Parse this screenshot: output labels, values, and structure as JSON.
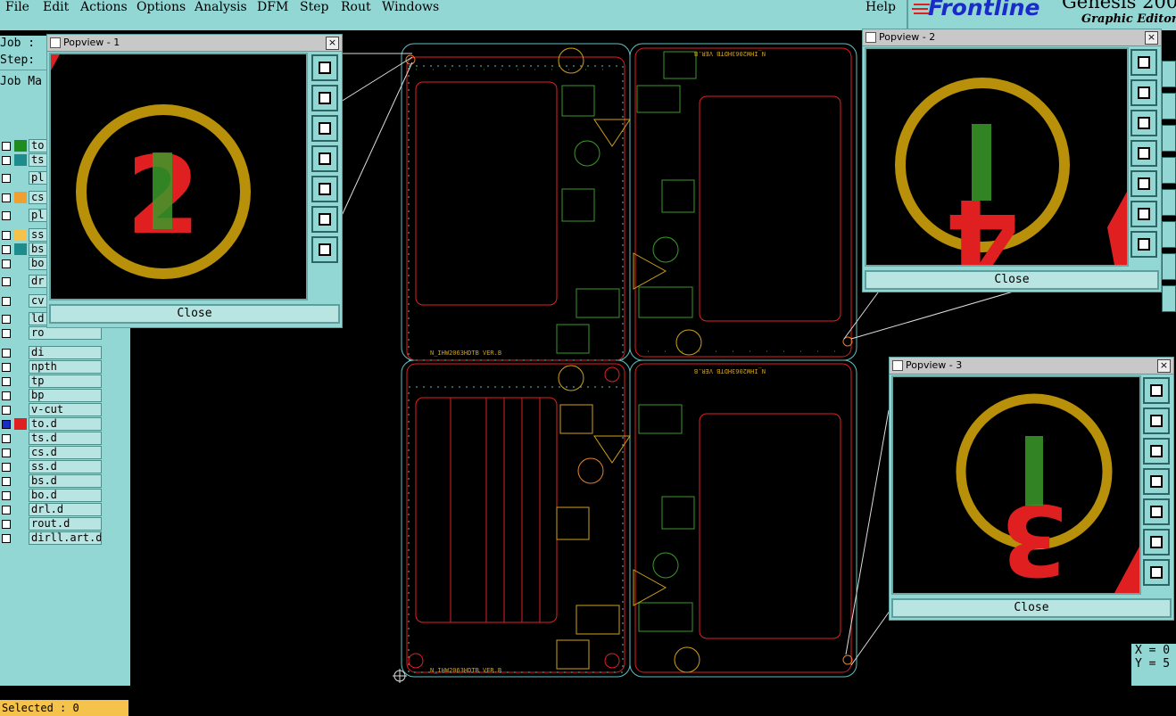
{
  "menu": {
    "items": [
      "File",
      "Edit",
      "Actions",
      "Options",
      "Analysis",
      "DFM",
      "Step",
      "Rout",
      "Windows"
    ],
    "help": "Help"
  },
  "logo": {
    "brand": "Frontline",
    "product": "Genesis 2000",
    "subtitle": "Graphic Editor"
  },
  "left_panel": {
    "job_label": "Job :",
    "step_label": "Step:",
    "job_matrix_label": "Job Ma",
    "layers": [
      {
        "name": "to",
        "color": "#1e8c1e"
      },
      {
        "name": "ts",
        "color": "#1e8c8c"
      },
      {
        "name": "pl",
        "color": ""
      },
      {
        "name": "cs",
        "color": "#f0a030"
      },
      {
        "name": "pl",
        "color": ""
      },
      {
        "name": "ss",
        "color": "#f5c24b"
      },
      {
        "name": "bs",
        "color": "#1e8c8c"
      },
      {
        "name": "bo",
        "color": ""
      },
      {
        "name": "dr",
        "color": ""
      },
      {
        "name": "cv",
        "color": ""
      },
      {
        "name": "ld",
        "color": ""
      },
      {
        "name": "ro",
        "color": ""
      },
      {
        "name": "di",
        "color": ""
      },
      {
        "name": "npth",
        "color": ""
      },
      {
        "name": "tp",
        "color": ""
      },
      {
        "name": "bp",
        "color": ""
      },
      {
        "name": "v-cut",
        "color": ""
      },
      {
        "name": "to.d",
        "color": "#e02020",
        "selected": true
      },
      {
        "name": "ts.d",
        "color": ""
      },
      {
        "name": "cs.d",
        "color": ""
      },
      {
        "name": "ss.d",
        "color": ""
      },
      {
        "name": "bs.d",
        "color": ""
      },
      {
        "name": "bo.d",
        "color": ""
      },
      {
        "name": "drl.d",
        "color": ""
      },
      {
        "name": "rout.d",
        "color": ""
      },
      {
        "name": "dirll.art.d",
        "color": ""
      }
    ],
    "selected_text": "Selected : 0"
  },
  "popviews": [
    {
      "title": "Popview - 1",
      "close": "Close",
      "number": "2"
    },
    {
      "title": "Popview - 2",
      "close": "Close",
      "number": "4"
    },
    {
      "title": "Popview - 3",
      "close": "Close",
      "number": "3"
    }
  ],
  "coords": {
    "x": "X = 0",
    "y": "Y = 5"
  },
  "board_text": {
    "label_tl": "N_IHW2063HDTB VER.B",
    "label_bl": "N_IHW2063HDTB VER.B",
    "label_tr": "N_IHW2063HDTB VER.B",
    "label_br": "N_IHW2063HDTB VER.B"
  },
  "colors": {
    "ui": "#93d7d5",
    "outline": "#5fbfbf",
    "copper": "#e02020",
    "silk": "#cfa01a",
    "green": "#3a9a2a"
  }
}
